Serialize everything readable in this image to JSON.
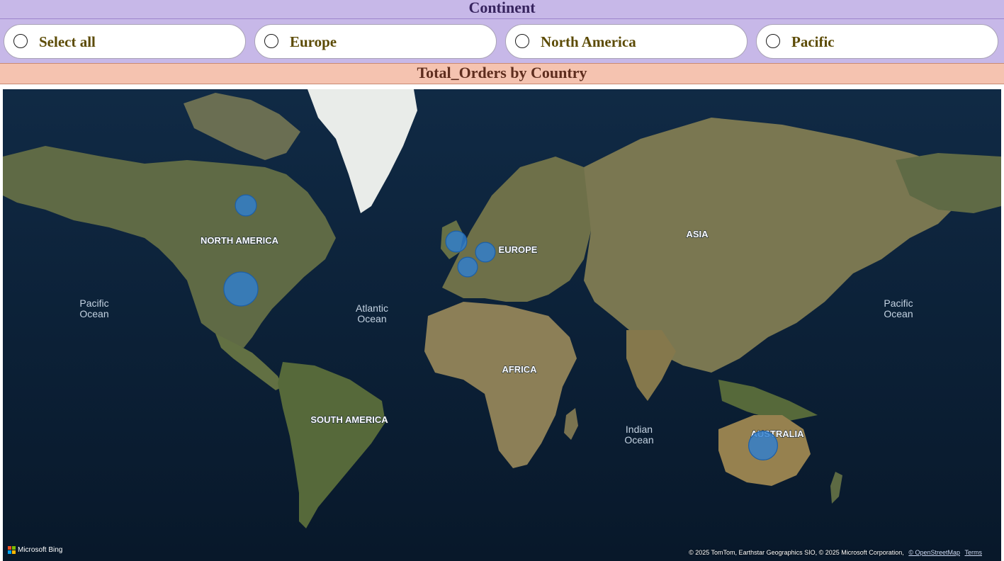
{
  "slicer": {
    "title": "Continent",
    "options": [
      {
        "label": "Select all",
        "selected": false
      },
      {
        "label": "Europe",
        "selected": false
      },
      {
        "label": "North America",
        "selected": false
      },
      {
        "label": "Pacific",
        "selected": false
      }
    ]
  },
  "map_visual": {
    "title": "Total_Orders by Country",
    "region_labels": {
      "north_america": "NORTH AMERICA",
      "europe": "EUROPE",
      "asia": "ASIA",
      "africa": "AFRICA",
      "south_america": "SOUTH AMERICA",
      "australia": "AUSTRALIA"
    },
    "ocean_labels": {
      "pacific_west_1": "Pacific",
      "pacific_west_2": "Ocean",
      "atlantic_1": "Atlantic",
      "atlantic_2": "Ocean",
      "indian_1": "Indian",
      "indian_2": "Ocean",
      "pacific_east_1": "Pacific",
      "pacific_east_2": "Ocean"
    },
    "bubble_color": "#2f7fd0",
    "bubbles": [
      {
        "name": "canada-bubble",
        "relative_size": 0.62
      },
      {
        "name": "united-states-bubble",
        "relative_size": 1.0
      },
      {
        "name": "united-kingdom-bubble",
        "relative_size": 0.62
      },
      {
        "name": "germany-bubble",
        "relative_size": 0.58
      },
      {
        "name": "france-bubble",
        "relative_size": 0.58
      },
      {
        "name": "australia-bubble",
        "relative_size": 0.85
      }
    ],
    "logo_text": "Microsoft Bing",
    "attribution_text": "© 2025 TomTom, Earthstar Geographics SIO, © 2025 Microsoft Corporation,",
    "osm_link": "© OpenStreetMap",
    "terms_link": "Terms"
  }
}
